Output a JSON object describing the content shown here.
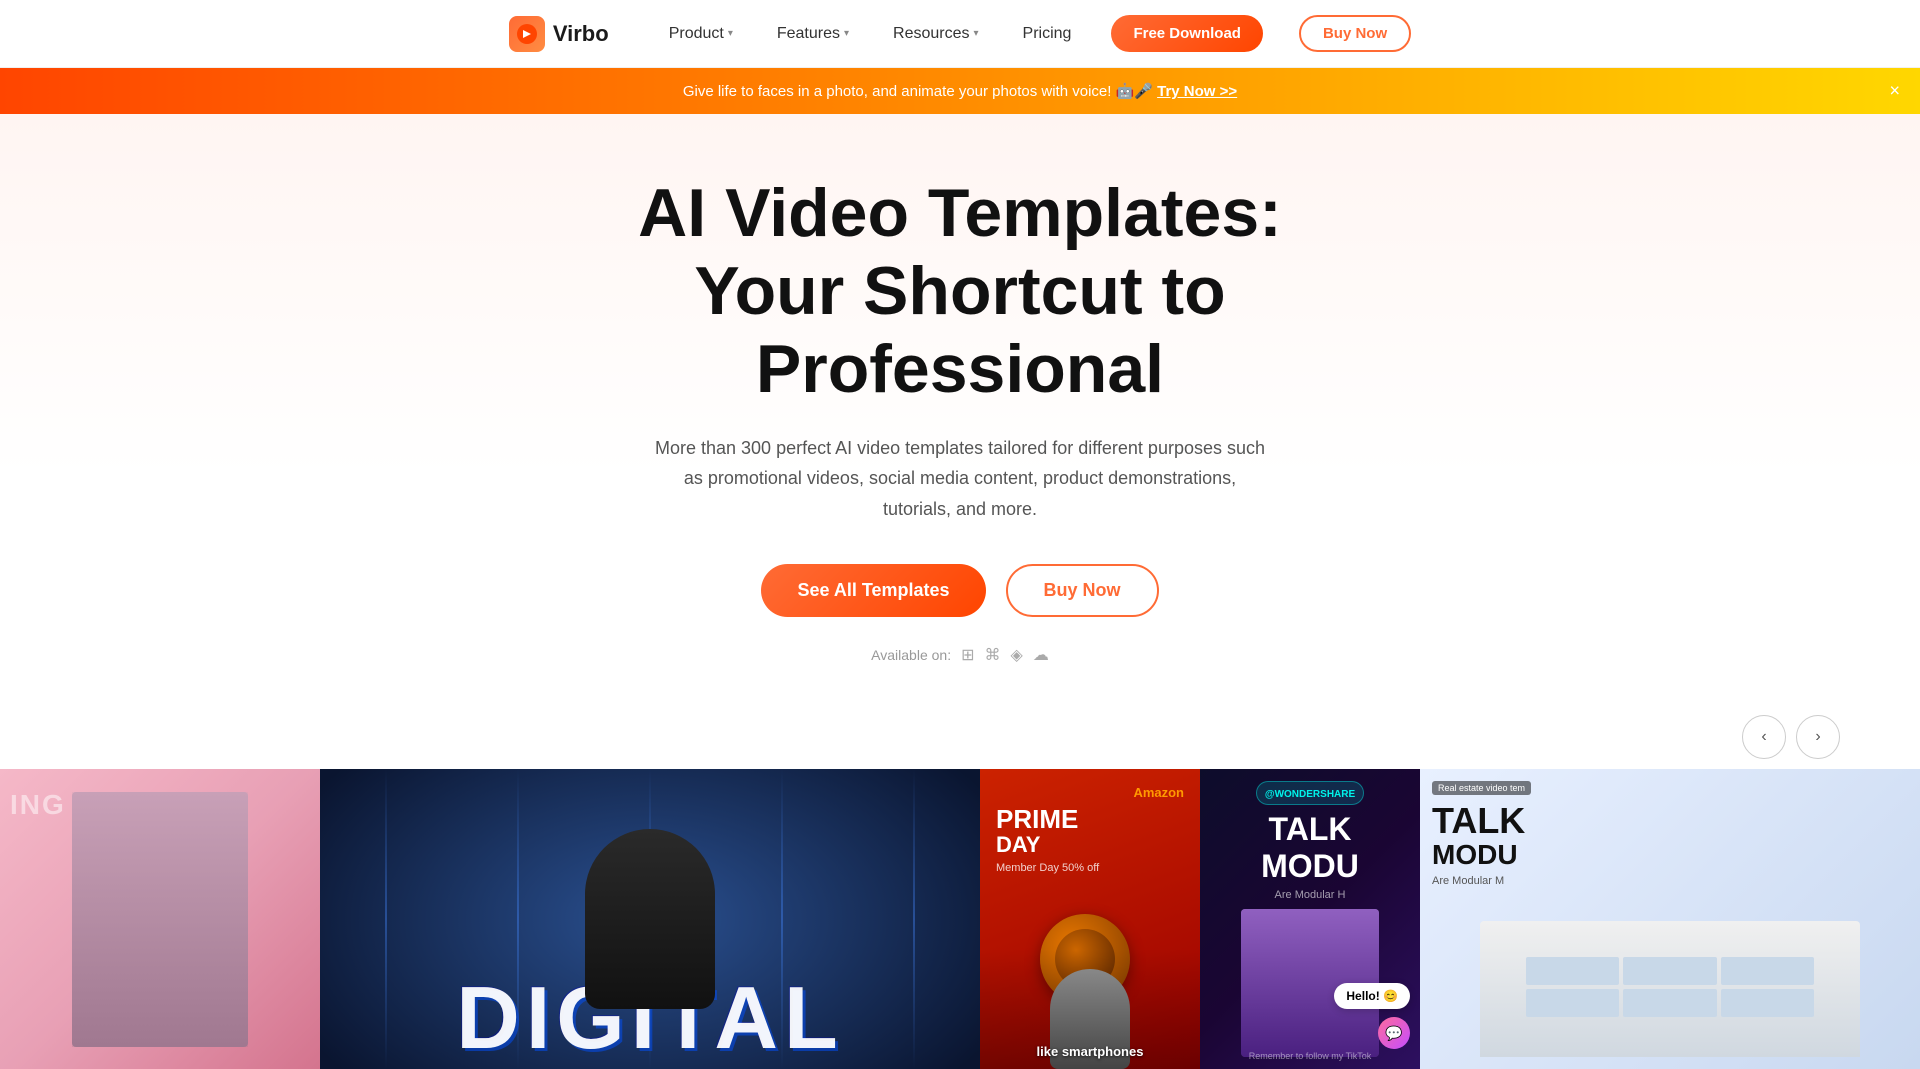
{
  "navbar": {
    "logo_text": "Virbo",
    "product_label": "Product",
    "features_label": "Features",
    "resources_label": "Resources",
    "pricing_label": "Pricing",
    "free_download_label": "Free Download",
    "buy_now_label": "Buy Now"
  },
  "announcement": {
    "text": "Give life to faces in a photo, and animate your photos with voice! 🤖🎤",
    "cta_text": "Try Now >>",
    "close_label": "×"
  },
  "hero": {
    "title_line1": "AI Video Templates:",
    "title_line2": "Your Shortcut to Professional",
    "subtitle": "More than 300 perfect AI video templates tailored for different purposes such as promotional videos, social media content, product demonstrations, tutorials, and more.",
    "see_all_templates_label": "See All Templates",
    "buy_now_label": "Buy Now",
    "available_on_label": "Available on:"
  },
  "carousel": {
    "prev_label": "‹",
    "next_label": "›"
  },
  "cards": [
    {
      "id": "pink",
      "overlay_text": "ING"
    },
    {
      "id": "main",
      "text": "DIGITAL"
    },
    {
      "id": "amazon",
      "badge": "Amazon",
      "prime_text": "PRIME",
      "day_text": "DAY",
      "member_text": "Member Day 50% off",
      "bottom_text": "like smartphones"
    },
    {
      "id": "tiktok",
      "handle": "@WONDERSHARE",
      "talk_label": "TALK",
      "modu_label": "MODU",
      "sub_label": "Are Modular H",
      "hello_label": "Hello! 😊",
      "remember_text": "Remember to follow my TikTok"
    },
    {
      "id": "realestate",
      "tag": "Real estate video tem",
      "talk": "TALK",
      "modular": "MODU",
      "desc": "Are Modular M"
    }
  ]
}
